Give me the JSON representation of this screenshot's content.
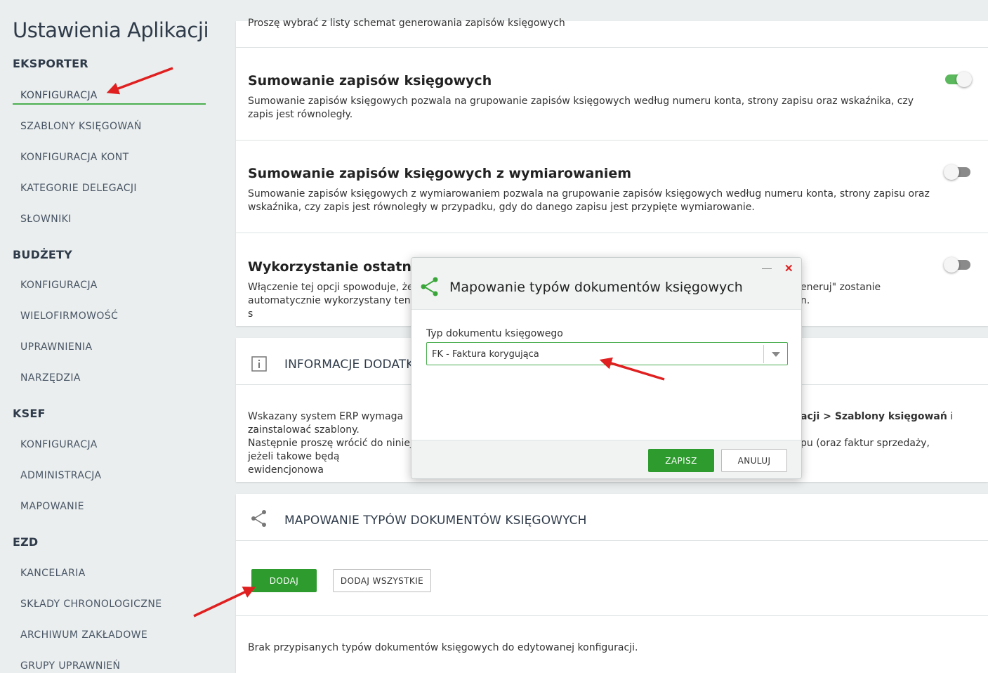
{
  "sidebar": {
    "title": "Ustawienia Aplikacji",
    "sections": [
      {
        "title": "EKSPORTER",
        "items": [
          "KONFIGURACJA",
          "SZABLONY KSIĘGOWAŃ",
          "KONFIGURACJA KONT",
          "KATEGORIE DELEGACJI",
          "SŁOWNIKI"
        ]
      },
      {
        "title": "BUDŻETY",
        "items": [
          "KONFIGURACJA",
          "WIELOFIRMOWOŚĆ",
          "UPRAWNIENIA",
          "NARZĘDZIA"
        ]
      },
      {
        "title": "KSEF",
        "items": [
          "KONFIGURACJA",
          "ADMINISTRACJA",
          "MAPOWANIE"
        ]
      },
      {
        "title": "EZD",
        "items": [
          "KANCELARIA",
          "SKŁADY CHRONOLOGICZNE",
          "ARCHIWUM ZAKŁADOWE",
          "GRUPY UPRAWNIEŃ"
        ]
      }
    ]
  },
  "main": {
    "top_text": "Proszę wybrać z listy schemat generowania zapisów księgowych",
    "rows": [
      {
        "title": "Sumowanie zapisów księgowych",
        "desc": "Sumowanie zapisów księgowych pozwala na grupowanie zapisów księgowych według numeru konta, strony zapisu oraz wskaźnika, czy zapis jest równoległy.",
        "enabled": true
      },
      {
        "title": "Sumowanie zapisów księgowych z wymiarowaniem",
        "desc": "Sumowanie zapisów księgowych z wymiarowaniem pozwala na grupowanie zapisów księgowych według numeru konta, strony zapisu oraz wskaźnika, czy zapis jest równoległy w przypadku, gdy do danego zapisu jest przypięte wymiarowanie.",
        "enabled": false
      },
      {
        "title_visible": "Wykorzystanie ostatnio uż",
        "desc_left_1": "Włączenie tej opcji spowoduje, że",
        "desc_left_2": "automatycznie wykorzystany ten s",
        "desc_right_1": "eneruj\" zostanie",
        "desc_right_2": "n.",
        "enabled": false
      }
    ],
    "info": {
      "header": "INFORMACJE DODATK",
      "line1_left": "Wskazany system ERP wymaga za",
      "line1_right_bold": "acji > Szablony księgowań",
      "line1_right_tail": " i",
      "line2": "zainstalować szablony.",
      "line3_left": "Następnie proszę wrócić do niniej",
      "line3_right": "pu (oraz faktur sprzedaży,",
      "line4_left": "jeżeli takowe będą ewidencjonowa"
    },
    "mapping": {
      "header": "MAPOWANIE TYPÓW DOKUMENTÓW KSIĘGOWYCH",
      "add_label": "DODAJ",
      "add_all_label": "DODAJ WSZYSTKIE",
      "empty_text": "Brak przypisanych typów dokumentów księgowych do edytowanej konfiguracji."
    }
  },
  "modal": {
    "title": "Mapowanie typów dokumentów księgowych",
    "field_label": "Typ dokumentu księgowego",
    "selected_value": "FK - Faktura korygująca",
    "save_label": "ZAPISZ",
    "cancel_label": "ANULUJ",
    "minimize_glyph": "—",
    "close_glyph": "✕"
  },
  "colors": {
    "accent_green": "#2e9b2e",
    "annotation_red": "#e02020",
    "toggle_on": "#5cb85c"
  }
}
